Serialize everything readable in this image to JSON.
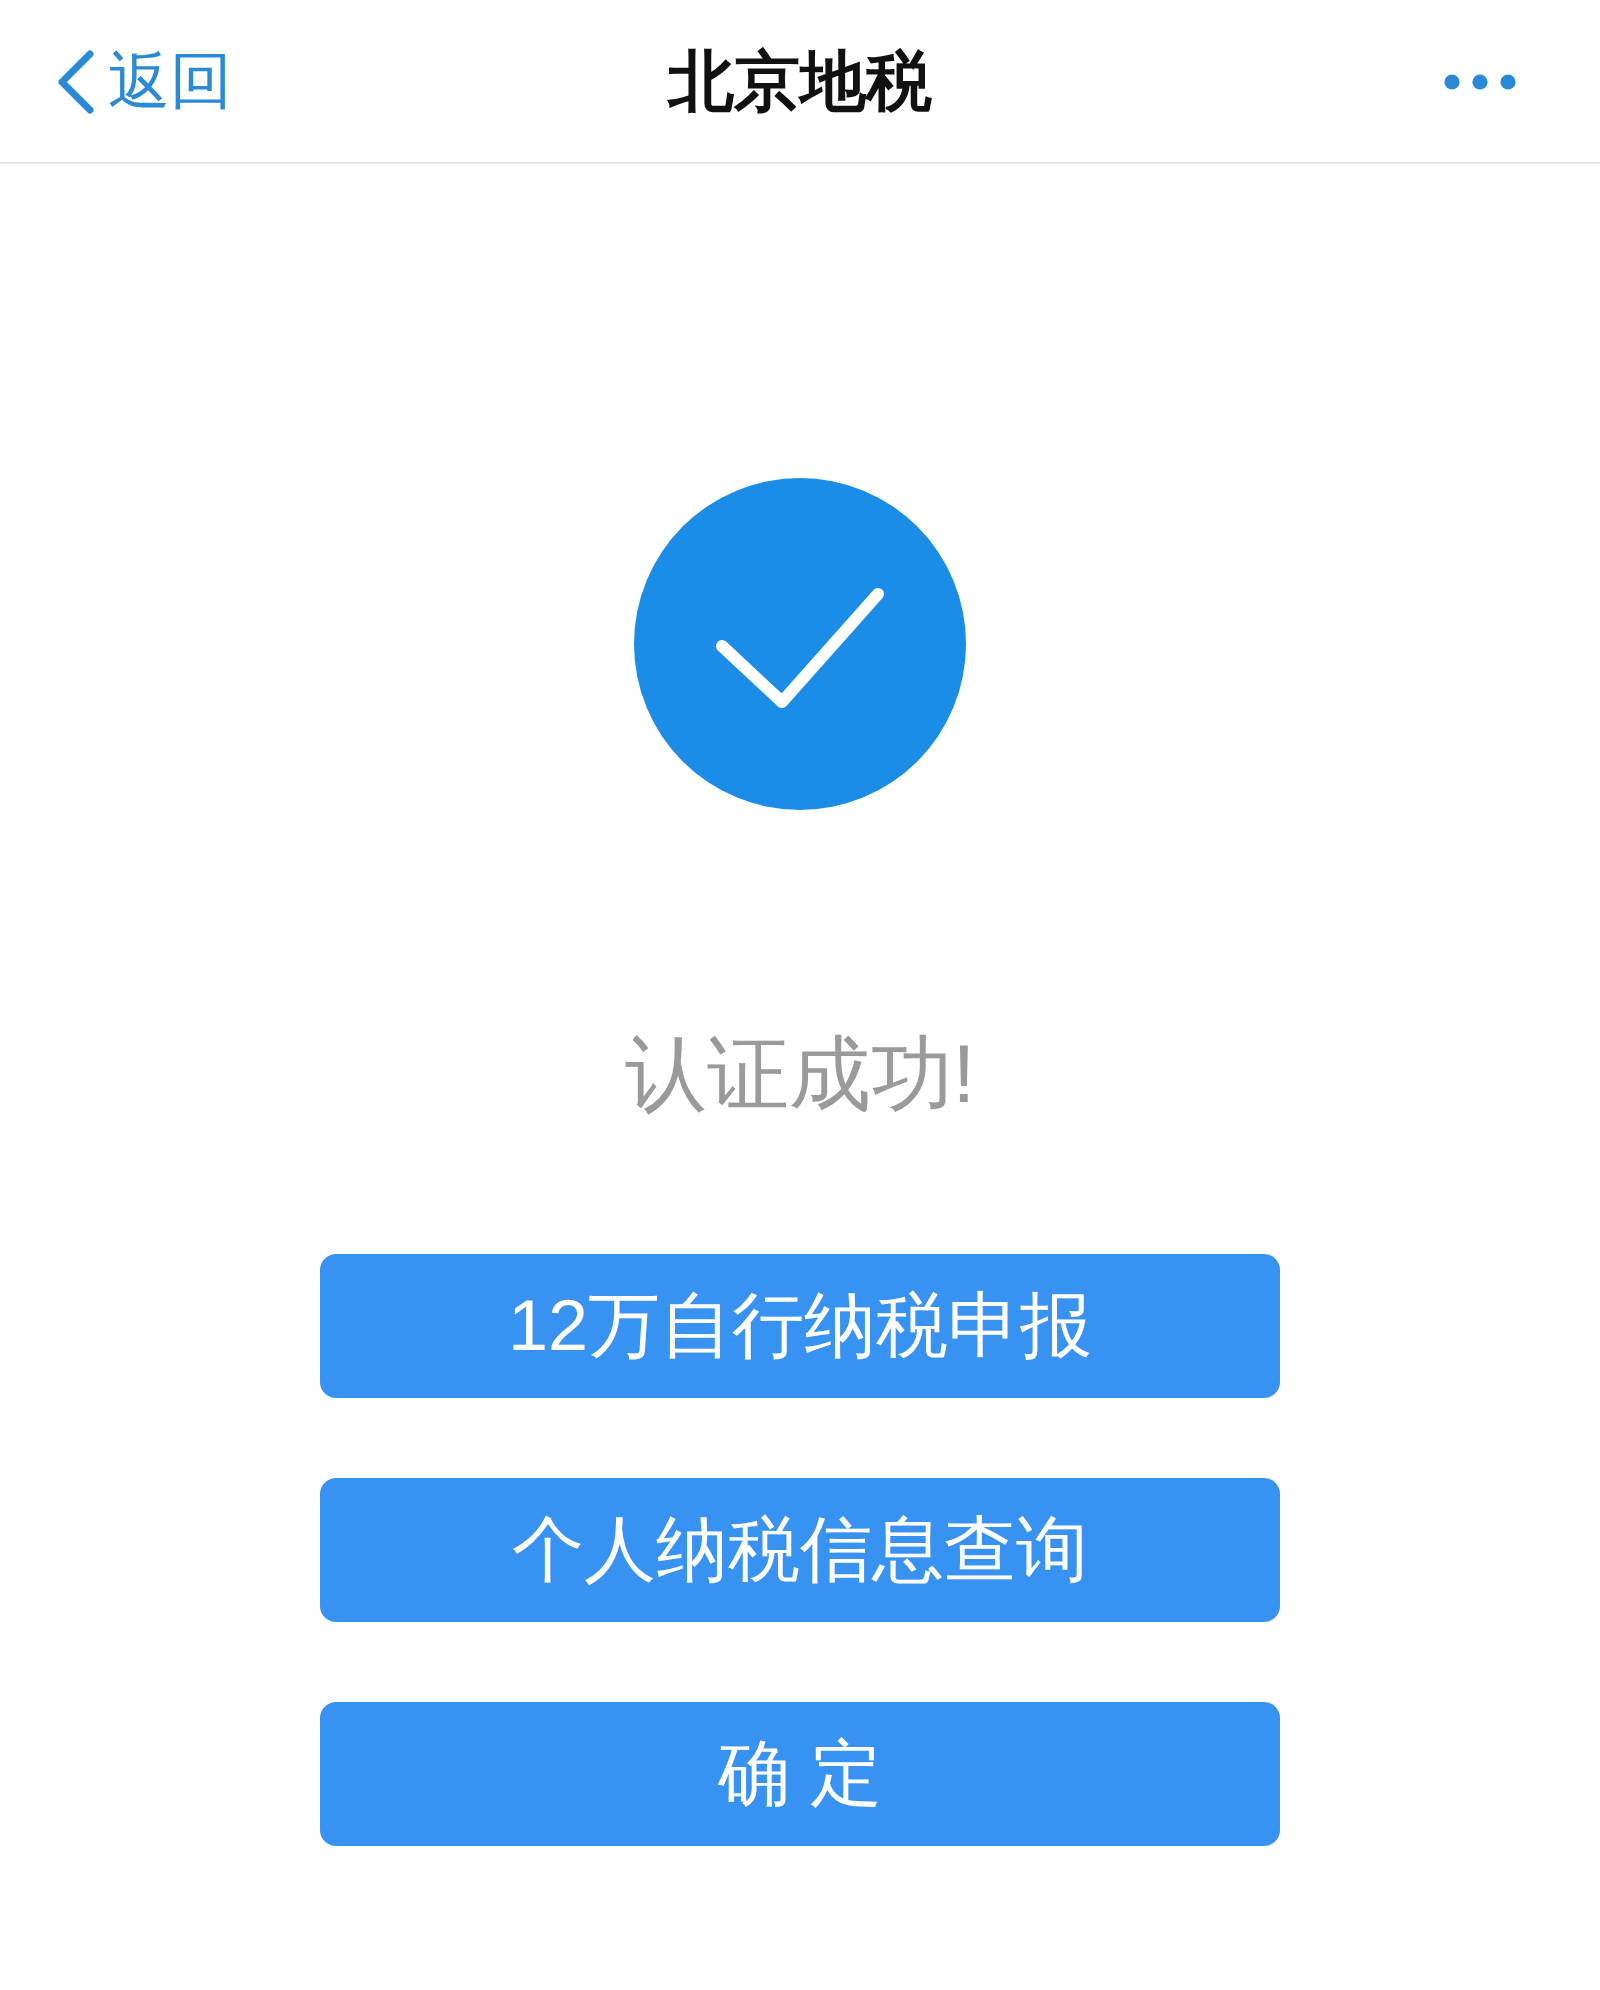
{
  "header": {
    "back_label": "返回",
    "title": "北京地税"
  },
  "result": {
    "message": "认证成功!"
  },
  "buttons": [
    {
      "label": "12万自行纳税申报"
    },
    {
      "label": "个人纳税信息查询"
    },
    {
      "label": "确 定"
    }
  ]
}
